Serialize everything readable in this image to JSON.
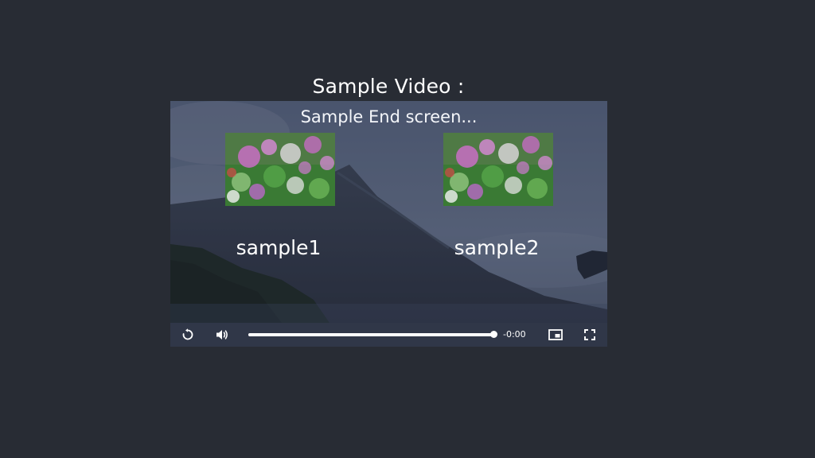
{
  "page": {
    "title": "Sample Video :"
  },
  "player": {
    "end_screen_title": "Sample End screen...",
    "cards": [
      {
        "label": "sample1"
      },
      {
        "label": "sample2"
      }
    ],
    "controls": {
      "replay_icon": "replay-icon",
      "volume_icon": "volume-icon",
      "progress_fraction": 1.0,
      "time_remaining": "-0:00",
      "pip_icon": "picture-in-picture-icon",
      "fullscreen_icon": "fullscreen-icon"
    }
  }
}
